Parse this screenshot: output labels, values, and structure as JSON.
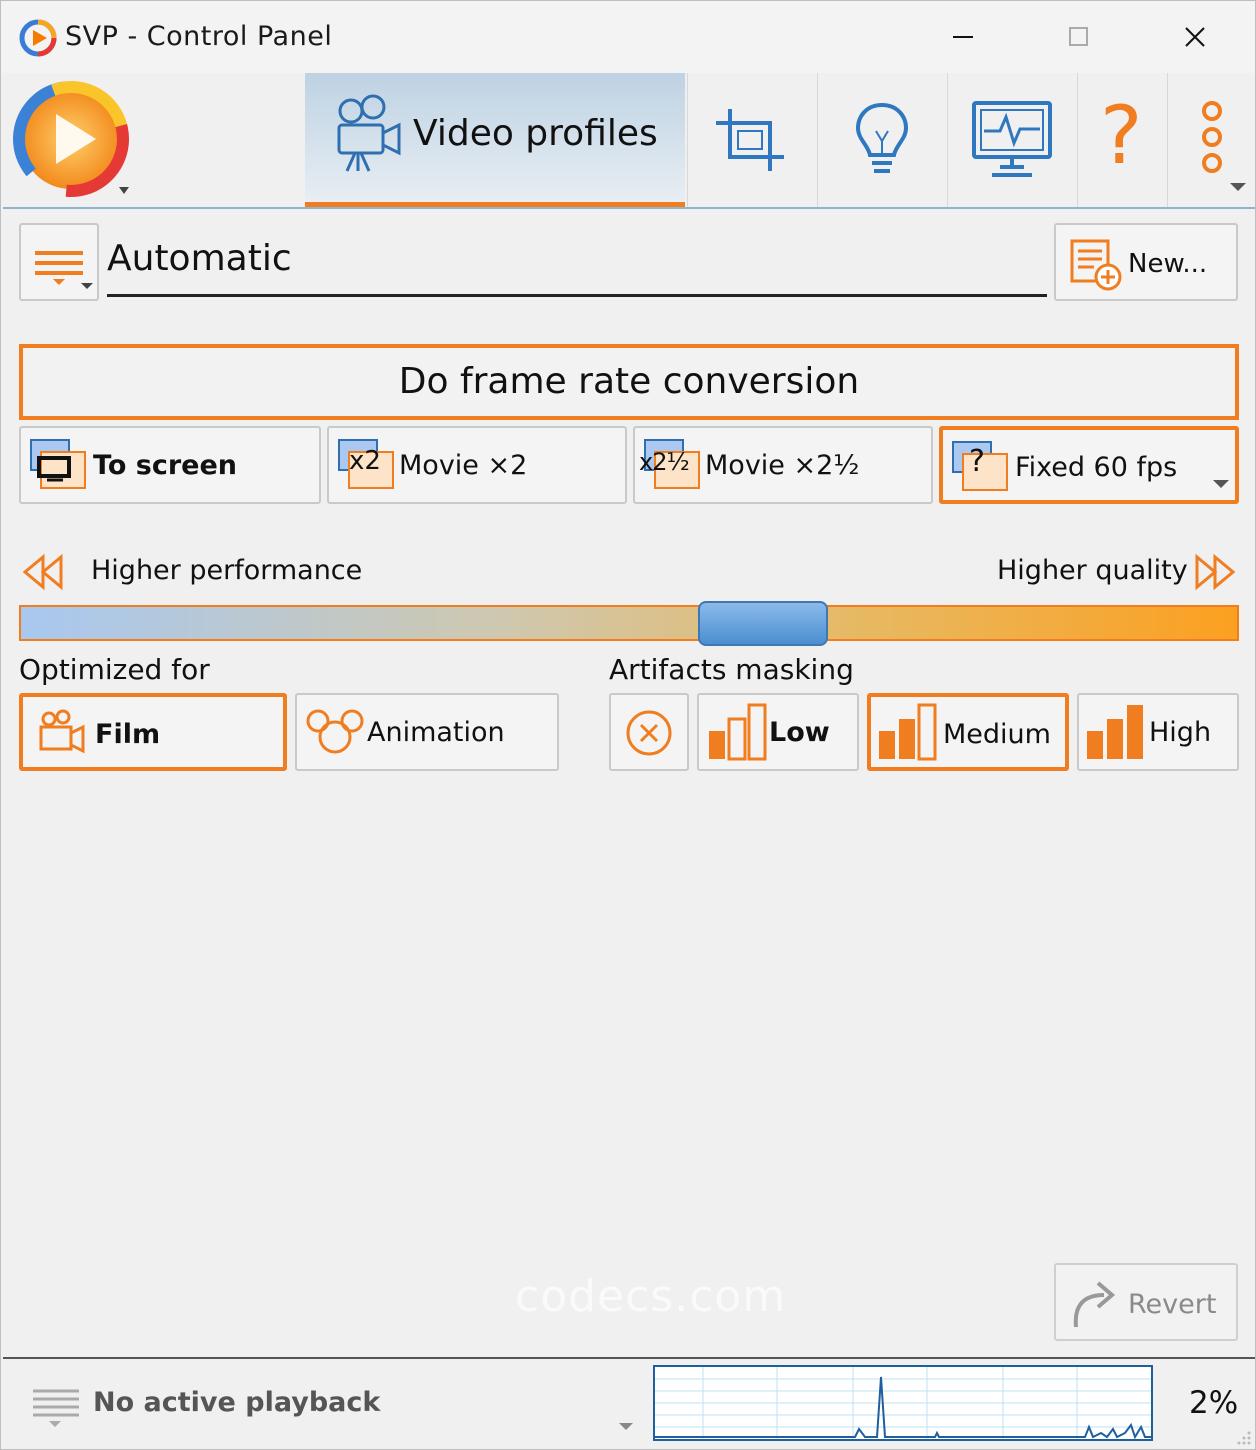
{
  "window": {
    "title": "SVP - Control Panel"
  },
  "toolbar": {
    "active_tab_label": "Video profiles",
    "help_glyph": "?",
    "icons": [
      "svp-logo-icon",
      "video-camera-icon",
      "crop-icon",
      "lightbulb-icon",
      "monitor-icon",
      "help-icon",
      "more-icon"
    ]
  },
  "profile": {
    "name": "Automatic",
    "new_label": "New..."
  },
  "frame_rate": {
    "toggle_label": "Do frame rate conversion",
    "modes": [
      {
        "label": "To screen",
        "icon_text": "",
        "selected": false
      },
      {
        "label": "Movie ×2",
        "icon_text": "x2",
        "selected": false
      },
      {
        "label": "Movie ×2½",
        "icon_text": "x2½",
        "selected": false
      },
      {
        "label": "Fixed 60 fps",
        "icon_text": "?",
        "selected": true
      }
    ]
  },
  "quality": {
    "left_label": "Higher performance",
    "right_label": "Higher quality",
    "level": 0.61
  },
  "optimized_for": {
    "label": "Optimized for",
    "film": "Film",
    "animation": "Animation",
    "selected": "Film"
  },
  "artifacts": {
    "label": "Artifacts masking",
    "low": "Low",
    "medium": "Medium",
    "high": "High",
    "selected": "Medium"
  },
  "watermark": "codecs.com",
  "revert_label": "Revert",
  "status": {
    "text": "No active playback",
    "cpu_percent": "2%"
  },
  "colors": {
    "accent": "#f07d20",
    "selection_border": "#f07d20",
    "slider_thumb": "#4b8fd0",
    "graph_line": "#1f5f9e"
  }
}
